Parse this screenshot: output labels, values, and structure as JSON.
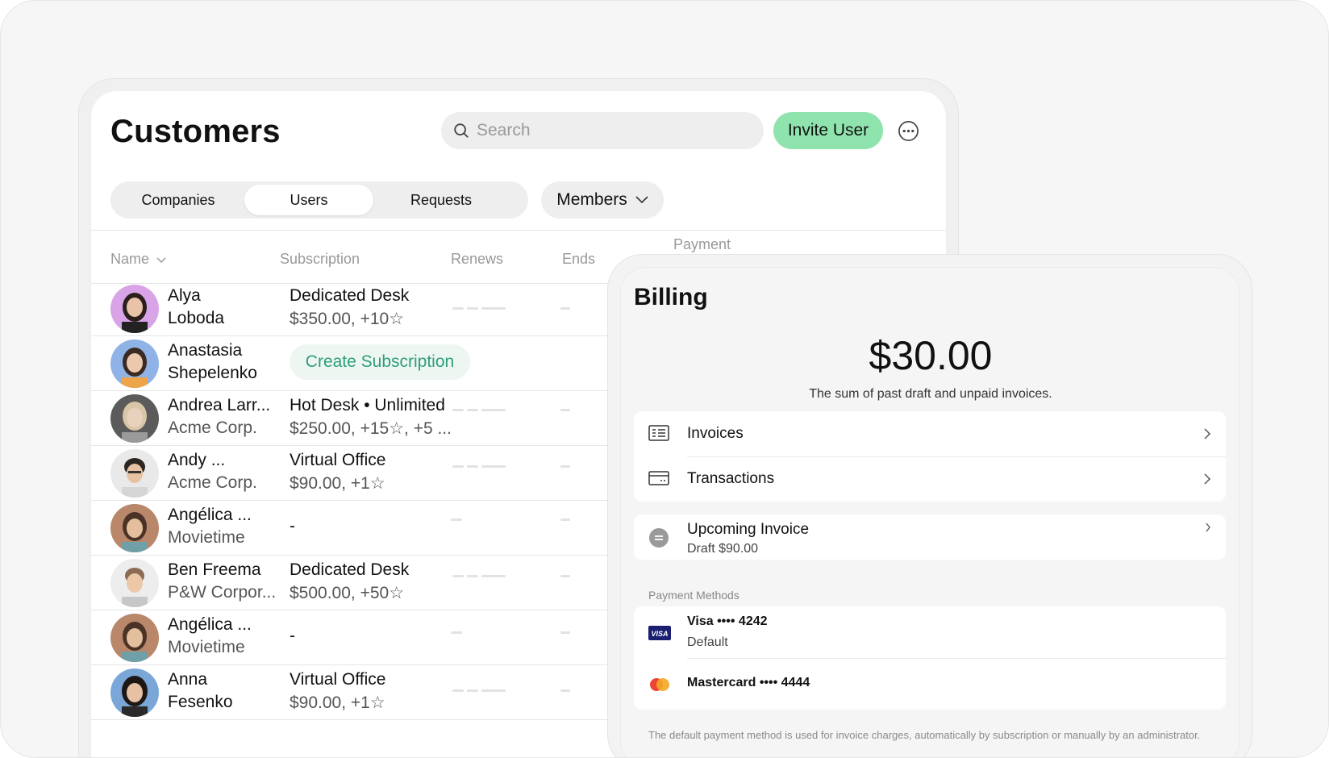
{
  "customers": {
    "title": "Customers",
    "search_placeholder": "Search",
    "invite_button": "Invite User",
    "tabs": [
      {
        "label": "Companies",
        "active": false
      },
      {
        "label": "Users",
        "active": true
      },
      {
        "label": "Requests",
        "active": false
      }
    ],
    "filter_label": "Members",
    "columns": {
      "name": "Name",
      "subscription": "Subscription",
      "renews": "Renews",
      "ends": "Ends",
      "payment": "Payment"
    },
    "rows": [
      {
        "name_line1": "Alya",
        "name_line2": "Loboda",
        "sub_line1": "Dedicated Desk",
        "sub_line2": "$350.00, +10☆"
      },
      {
        "name_line1": "Anastasia",
        "name_line2": "Shepelenko",
        "action": "Create Subscription"
      },
      {
        "name_line1": "Andrea Larr...",
        "name_line2": "Acme Corp.",
        "sub_line1": "Hot Desk • Unlimited",
        "sub_line2": "$250.00, +15☆, +5 ..."
      },
      {
        "name_line1": "Andy ...",
        "name_line2": "Acme Corp.",
        "sub_line1": "Virtual Office",
        "sub_line2": "$90.00, +1☆"
      },
      {
        "name_line1": "Angélica ...",
        "name_line2": "Movietime",
        "sub_single": "-"
      },
      {
        "name_line1": "Ben Freema",
        "name_line2": "P&W Corpor...",
        "sub_line1": "Dedicated Desk",
        "sub_line2": "$500.00, +50☆"
      },
      {
        "name_line1": "Angélica ...",
        "name_line2": "Movietime",
        "sub_single": "-"
      },
      {
        "name_line1": "Anna",
        "name_line2": "Fesenko",
        "sub_line1": "Virtual Office",
        "sub_line2": "$90.00, +1☆"
      }
    ]
  },
  "billing": {
    "title": "Billing",
    "amount": "$30.00",
    "amount_caption": "The sum of past draft and unpaid invoices.",
    "links": [
      {
        "label": "Invoices",
        "icon": "invoice-icon"
      },
      {
        "label": "Transactions",
        "icon": "card-icon"
      }
    ],
    "upcoming": {
      "title": "Upcoming Invoice",
      "subtitle": "Draft $90.00"
    },
    "payment_methods_label": "Payment Methods",
    "methods": [
      {
        "name": "Visa •••• 4242",
        "status": "Default",
        "icon": "visa-icon"
      },
      {
        "name": "Mastercard •••• 4444",
        "icon": "mastercard-icon"
      }
    ],
    "footnote": "The default payment method is used for invoice charges, automatically by subscription or manually by an administrator."
  },
  "colors": {
    "accent_green": "#8fe3ad",
    "create_sub_text": "#2e9e7a",
    "visa_blue": "#1a1f71"
  }
}
